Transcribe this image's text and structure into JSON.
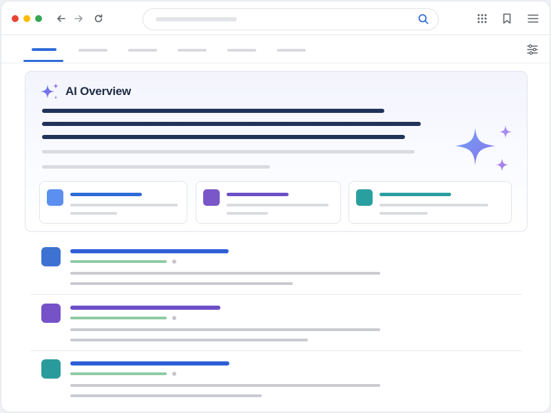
{
  "browser": {
    "window_controls": [
      "close",
      "minimize",
      "maximize"
    ],
    "nav_icons": [
      "back-arrow-icon",
      "forward-arrow-icon",
      "reload-icon"
    ],
    "toolbar_icons": [
      "apps-grid-icon",
      "bookmark-icon",
      "menu-icon"
    ],
    "search_icon": "search-icon"
  },
  "tabs": {
    "count": 6,
    "active_index": 0
  },
  "ai_overview": {
    "title": "AI Overview",
    "icon": "sparkle-icon",
    "sources": [
      {
        "icon_color": "#5b8ff0",
        "title_color": "#2f6bd8"
      },
      {
        "icon_color": "#7a57c9",
        "title_color": "#6c4fc7"
      },
      {
        "icon_color": "#2a9fa0",
        "title_color": "#2a9fa0"
      }
    ]
  },
  "results": [
    {
      "icon_color": "#3d72d2",
      "title_color": "#2f5fd6"
    },
    {
      "icon_color": "#7652c8",
      "title_color": "#6d4fc9"
    },
    {
      "icon_color": "#2a9b9c",
      "title_color": "#2f5fd6"
    }
  ],
  "colors": {
    "accent": "#2f6bd8",
    "url_green": "#8ecba5",
    "heading_navy": "#22335a"
  }
}
